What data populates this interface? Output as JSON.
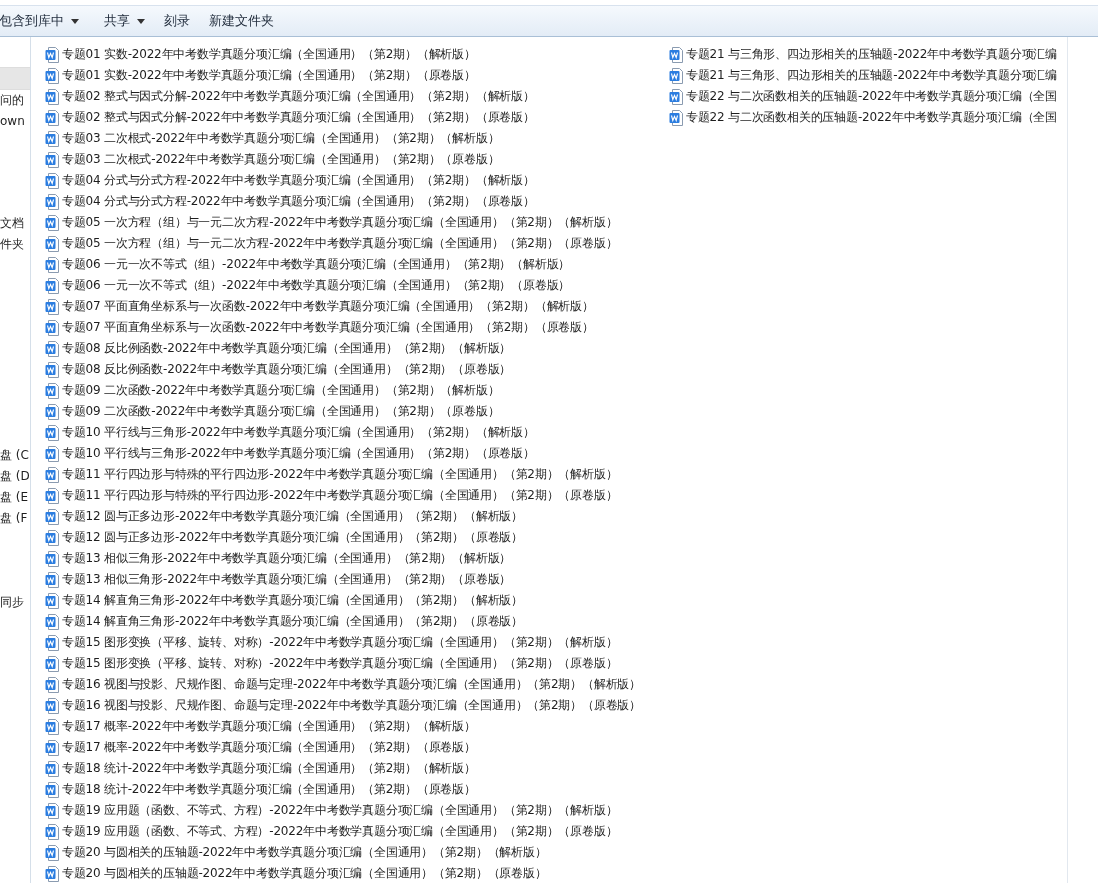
{
  "toolbar": [
    {
      "label": "包含到库中",
      "has_menu": true
    },
    {
      "label": "共享",
      "has_menu": true
    },
    {
      "label": "刻录",
      "has_menu": false
    },
    {
      "label": "新建文件夹",
      "has_menu": false
    }
  ],
  "sidebar": {
    "items": [
      {
        "selected": true
      },
      {
        "label": "问的",
        "selected": false
      },
      {
        "label": "own",
        "selected": false
      },
      {
        "label": "文档",
        "selected": false
      },
      {
        "label": "件夹",
        "selected": false
      },
      {
        "label": "盘 (C",
        "selected": false
      },
      {
        "label": "盘 (D",
        "selected": false
      },
      {
        "label": "盘 (E",
        "selected": false
      },
      {
        "label": "盘 (F",
        "selected": false
      },
      {
        "label": "同步",
        "selected": false
      }
    ]
  },
  "files": [
    {
      "name": "专题01 实数-2022年中考数学真题分项汇编（全国通用）（第2期）（解析版）"
    },
    {
      "name": "专题01 实数-2022年中考数学真题分项汇编（全国通用）（第2期）（原卷版）"
    },
    {
      "name": "专题02 整式与因式分解-2022年中考数学真题分项汇编（全国通用）（第2期）（解析版）"
    },
    {
      "name": "专题02 整式与因式分解-2022年中考数学真题分项汇编（全国通用）（第2期）（原卷版）"
    },
    {
      "name": "专题03 二次根式-2022年中考数学真题分项汇编（全国通用）（第2期）（解析版）"
    },
    {
      "name": "专题03 二次根式-2022年中考数学真题分项汇编（全国通用）（第2期）（原卷版）"
    },
    {
      "name": "专题04 分式与分式方程-2022年中考数学真题分项汇编（全国通用）（第2期）（解析版）"
    },
    {
      "name": "专题04 分式与分式方程-2022年中考数学真题分项汇编（全国通用）（第2期）（原卷版）"
    },
    {
      "name": "专题05 一次方程（组）与一元二次方程-2022年中考数学真题分项汇编（全国通用）（第2期）（解析版）"
    },
    {
      "name": "专题05 一次方程（组）与一元二次方程-2022年中考数学真题分项汇编（全国通用）（第2期）（原卷版）"
    },
    {
      "name": "专题06 一元一次不等式（组）-2022年中考数学真题分项汇编（全国通用）（第2期）（解析版）"
    },
    {
      "name": "专题06 一元一次不等式（组）-2022年中考数学真题分项汇编（全国通用）（第2期）（原卷版）"
    },
    {
      "name": "专题07 平面直角坐标系与一次函数-2022年中考数学真题分项汇编（全国通用）（第2期）（解析版）"
    },
    {
      "name": "专题07 平面直角坐标系与一次函数-2022年中考数学真题分项汇编（全国通用）（第2期）（原卷版）"
    },
    {
      "name": "专题08 反比例函数-2022年中考数学真题分项汇编（全国通用）（第2期）（解析版）"
    },
    {
      "name": "专题08 反比例函数-2022年中考数学真题分项汇编（全国通用）（第2期）（原卷版）"
    },
    {
      "name": "专题09 二次函数-2022年中考数学真题分项汇编（全国通用）（第2期）（解析版）"
    },
    {
      "name": "专题09 二次函数-2022年中考数学真题分项汇编（全国通用）（第2期）（原卷版）"
    },
    {
      "name": "专题10 平行线与三角形-2022年中考数学真题分项汇编（全国通用）（第2期）（解析版）"
    },
    {
      "name": "专题10 平行线与三角形-2022年中考数学真题分项汇编（全国通用）（第2期）（原卷版）"
    },
    {
      "name": "专题11 平行四边形与特殊的平行四边形-2022年中考数学真题分项汇编（全国通用）（第2期）（解析版）"
    },
    {
      "name": "专题11 平行四边形与特殊的平行四边形-2022年中考数学真题分项汇编（全国通用）（第2期）（原卷版）"
    },
    {
      "name": "专题12 圆与正多边形-2022年中考数学真题分项汇编（全国通用）（第2期）（解析版）"
    },
    {
      "name": "专题12 圆与正多边形-2022年中考数学真题分项汇编（全国通用）（第2期）（原卷版）"
    },
    {
      "name": "专题13 相似三角形-2022年中考数学真题分项汇编（全国通用）（第2期）（解析版）"
    },
    {
      "name": "专题13 相似三角形-2022年中考数学真题分项汇编（全国通用）（第2期）（原卷版）"
    },
    {
      "name": "专题14 解直角三角形-2022年中考数学真题分项汇编（全国通用）（第2期）（解析版）"
    },
    {
      "name": "专题14 解直角三角形-2022年中考数学真题分项汇编（全国通用）（第2期）（原卷版）"
    },
    {
      "name": "专题15 图形变换（平移、旋转、对称）-2022年中考数学真题分项汇编（全国通用）（第2期）（解析版）"
    },
    {
      "name": "专题15 图形变换（平移、旋转、对称）-2022年中考数学真题分项汇编（全国通用）（第2期）（原卷版）"
    },
    {
      "name": "专题16 视图与投影、尺规作图、命题与定理-2022年中考数学真题分项汇编（全国通用）（第2期）（解析版）"
    },
    {
      "name": "专题16 视图与投影、尺规作图、命题与定理-2022年中考数学真题分项汇编（全国通用）（第2期）（原卷版）"
    },
    {
      "name": "专题17 概率-2022年中考数学真题分项汇编（全国通用）（第2期）（解析版）"
    },
    {
      "name": "专题17 概率-2022年中考数学真题分项汇编（全国通用）（第2期）（原卷版）"
    },
    {
      "name": "专题18 统计-2022年中考数学真题分项汇编（全国通用）（第2期）（解析版）"
    },
    {
      "name": "专题18 统计-2022年中考数学真题分项汇编（全国通用）（第2期）（原卷版）"
    },
    {
      "name": "专题19 应用题（函数、不等式、方程）-2022年中考数学真题分项汇编（全国通用）（第2期）（解析版）"
    },
    {
      "name": "专题19 应用题（函数、不等式、方程）-2022年中考数学真题分项汇编（全国通用）（第2期）（原卷版）"
    },
    {
      "name": "专题20 与圆相关的压轴题-2022年中考数学真题分项汇编（全国通用）（第2期）（解析版）"
    },
    {
      "name": "专题20 与圆相关的压轴题-2022年中考数学真题分项汇编（全国通用）（第2期）（原卷版）"
    },
    {
      "name": "专题21 与三角形、四边形相关的压轴题-2022年中考数学真题分项汇编"
    },
    {
      "name": "专题21 与三角形、四边形相关的压轴题-2022年中考数学真题分项汇编"
    },
    {
      "name": "专题22 与二次函数相关的压轴题-2022年中考数学真题分项汇编（全国"
    },
    {
      "name": "专题22 与二次函数相关的压轴题-2022年中考数学真题分项汇编（全国"
    }
  ]
}
